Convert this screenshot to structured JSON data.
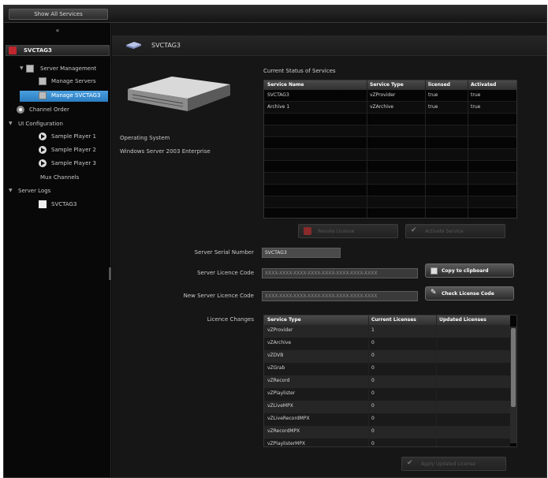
{
  "topbar": {
    "show_all_label": "Show All Services"
  },
  "sidebar": {
    "collapse_glyph": "«",
    "header": "SVCTAG3",
    "items": [
      {
        "label": "Server Management",
        "icon": "server-icon",
        "indent": 1,
        "arrow": "▼"
      },
      {
        "label": "Manage Servers",
        "icon": "server-icon",
        "indent": 2
      },
      {
        "label": "Manage SVCTAG3",
        "icon": "server-icon",
        "indent": 2,
        "selected": true
      },
      {
        "label": "Channel Order",
        "icon": "disc-icon",
        "indent": 0
      },
      {
        "label": "UI Configuration",
        "icon": "",
        "indent": 0,
        "arrow": "▼"
      },
      {
        "label": "Sample Player 1",
        "icon": "play-icon",
        "indent": 2
      },
      {
        "label": "Sample Player 2",
        "icon": "play-icon",
        "indent": 2
      },
      {
        "label": "Sample Player 3",
        "icon": "play-icon",
        "indent": 2
      },
      {
        "label": "Mux Channels",
        "icon": "",
        "indent": 1
      },
      {
        "label": "Server Logs",
        "icon": "",
        "indent": 0,
        "arrow": "▼"
      },
      {
        "label": "SVCTAG3",
        "icon": "doc-icon",
        "indent": 2
      }
    ]
  },
  "main": {
    "title": "SVCTAG3",
    "os_label": "Operating System",
    "os_value": "Windows Server 2003 Enterprise",
    "status": {
      "title": "Current Status of Services",
      "headers": [
        "Service Name",
        "Service Type",
        "licensed",
        "Activated"
      ],
      "rows": [
        [
          "SVCTAG3",
          "vZProvider",
          "true",
          "true"
        ],
        [
          "Archive 1",
          "vZArchive",
          "true",
          "true"
        ]
      ]
    },
    "btn_revoke": "Revoke License",
    "btn_activate": "Activate Service",
    "serial_label": "Server Serial Number",
    "serial_value": "SVCTAG3",
    "license_label": "Server Licence Code",
    "license_value": "XXXX-XXXX-XXXX-XXXX-XXXX-XXXX-XXXX-XXXX",
    "copy_btn": "Copy to clipboard",
    "new_license_label": "New Server Licence Code",
    "new_license_value": "XXXX-XXXX-XXXX-XXXX-XXXX-XXXX-XXXX-XXXX",
    "check_btn": "Check License Code",
    "changes_label": "Licence Changes",
    "changes": {
      "headers": [
        "Service Type",
        "Current Licenses",
        "Updated Licenses"
      ],
      "rows": [
        [
          "vZProvider",
          "1",
          ""
        ],
        [
          "vZArchive",
          "0",
          ""
        ],
        [
          "vZDVB",
          "0",
          ""
        ],
        [
          "vZGrab",
          "0",
          ""
        ],
        [
          "vZRecord",
          "0",
          ""
        ],
        [
          "vZPlaylister",
          "0",
          ""
        ],
        [
          "vZLiveMPX",
          "0",
          ""
        ],
        [
          "vZLiveRecordMPX",
          "0",
          ""
        ],
        [
          "vZRecordMPX",
          "0",
          ""
        ],
        [
          "vZPlaylisterMPX",
          "0",
          ""
        ]
      ]
    },
    "apply_btn": "Apply Updated License"
  },
  "colors": {
    "accent": "#2a7cc0",
    "brand_red": "#c0262e"
  }
}
